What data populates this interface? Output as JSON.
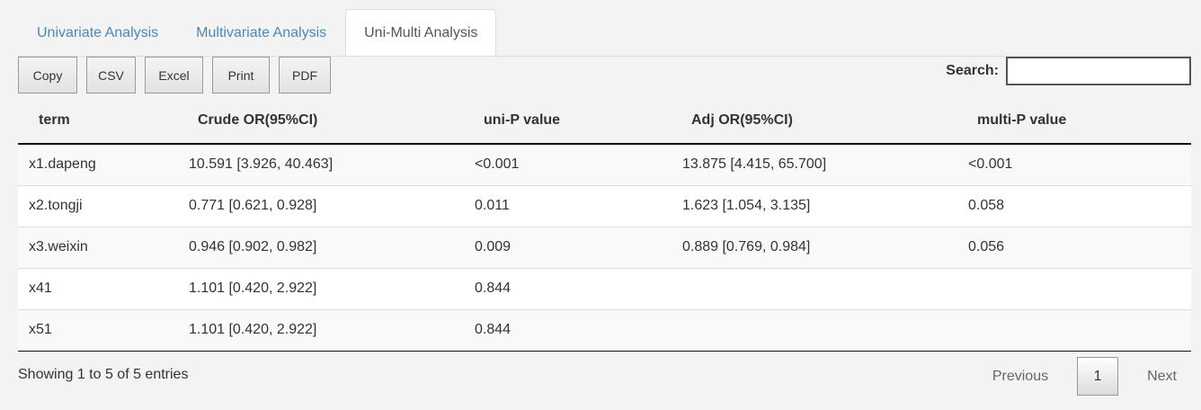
{
  "tabs": [
    {
      "label": "Univariate Analysis",
      "active": false
    },
    {
      "label": "Multivariate Analysis",
      "active": false
    },
    {
      "label": "Uni-Multi Analysis",
      "active": true
    }
  ],
  "toolbar": {
    "buttons": [
      "Copy",
      "CSV",
      "Excel",
      "Print",
      "PDF"
    ]
  },
  "search": {
    "label": "Search:",
    "value": ""
  },
  "table": {
    "headers": [
      "term",
      "Crude OR(95%CI)",
      "uni-P value",
      "Adj OR(95%CI)",
      "multi-P value"
    ],
    "rows": [
      [
        "x1.dapeng",
        "10.591 [3.926, 40.463]",
        "<0.001",
        "13.875 [4.415, 65.700]",
        "<0.001"
      ],
      [
        "x2.tongji",
        "0.771 [0.621, 0.928]",
        "0.011",
        "1.623 [1.054, 3.135]",
        "0.058"
      ],
      [
        "x3.weixin",
        "0.946 [0.902, 0.982]",
        "0.009",
        "0.889 [0.769, 0.984]",
        "0.056"
      ],
      [
        "x41",
        "1.101 [0.420, 2.922]",
        "0.844",
        "",
        ""
      ],
      [
        "x51",
        "1.101 [0.420, 2.922]",
        "0.844",
        "",
        ""
      ]
    ]
  },
  "footer": {
    "info": "Showing 1 to 5 of 5 entries",
    "previous": "Previous",
    "current_page": "1",
    "next": "Next"
  }
}
